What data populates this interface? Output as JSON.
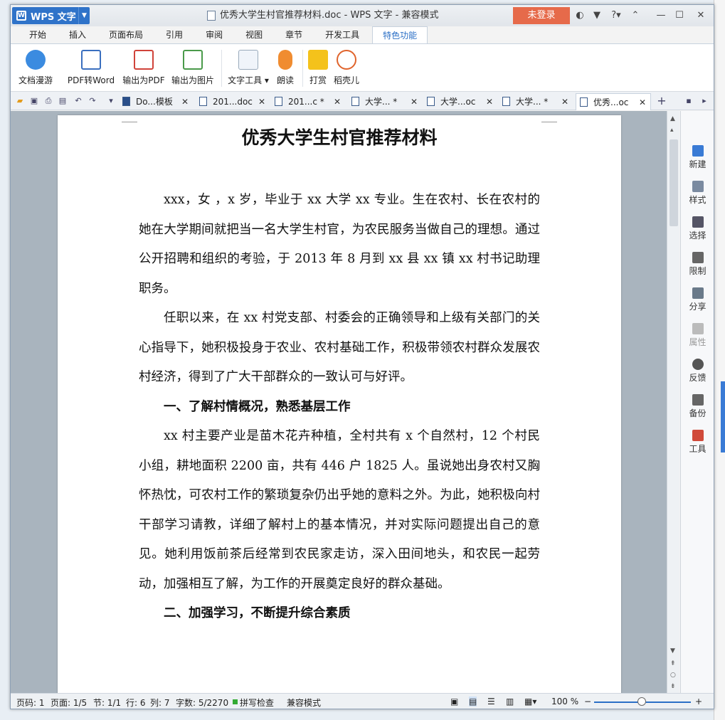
{
  "app": {
    "name": "WPS 文字",
    "window_title": "优秀大学生村官推荐材料.doc - WPS 文字 - 兼容模式",
    "login_label": "未登录"
  },
  "ribbon_tabs": [
    "开始",
    "插入",
    "页面布局",
    "引用",
    "审阅",
    "视图",
    "章节",
    "开发工具",
    "特色功能"
  ],
  "active_tab": "特色功能",
  "ribbon_buttons": [
    "文档漫游",
    "PDF转Word",
    "输出为PDF",
    "输出为图片",
    "文字工具",
    "朗读",
    "打赏",
    "稻壳儿"
  ],
  "doc_tabs": [
    {
      "label": "Do...模板"
    },
    {
      "label": "201...doc"
    },
    {
      "label": "201...c *"
    },
    {
      "label": "大学... *"
    },
    {
      "label": "大学...oc"
    },
    {
      "label": "大学... *"
    },
    {
      "label": "优秀...oc"
    }
  ],
  "document": {
    "title": "优秀大学生村官推荐材料",
    "p1": "xxx，女 ，x 岁，毕业于 xx 大学 xx 专业。生在农村、长在农村的她在大学期间就把当一名大学生村官，为农民服务当做自己的理想。通过公开招聘和组织的考验，于 2013 年 8 月到 xx 县 xx 镇 xx 村书记助理职务。",
    "p2": "任职以来，在 xx 村党支部、村委会的正确领导和上级有关部门的关心指导下，她积极投身于农业、农村基础工作，积极带领农村群众发展农村经济，得到了广大干部群众的一致认可与好评。",
    "h1": "一、了解村情概况，熟悉基层工作",
    "p3": "xx 村主要产业是苗木花卉种植，全村共有 x 个自然村，12 个村民小组，耕地面积 2200 亩，共有 446 户 1825 人。虽说她出身农村又胸怀热忱，可农村工作的繁琐复杂仍出乎她的意料之外。为此，她积极向村干部学习请教，详细了解村上的基本情况，并对实际问题提出自己的意见。她利用饭前茶后经常到农民家走访，深入田间地头，和农民一起劳动，加强相互了解，为工作的开展奠定良好的群众基础。",
    "h2": "二、加强学习，不断提升综合素质"
  },
  "sidebar": [
    "新建",
    "样式",
    "选择",
    "限制",
    "分享",
    "属性",
    "反馈",
    "备份",
    "工具"
  ],
  "status": {
    "page_no": "页码: 1",
    "pages": "页面: 1/5",
    "section": "节: 1/1",
    "row": "行: 6",
    "col": "列: 7",
    "words": "字数: 5/2270",
    "spell": "拼写检查",
    "mode": "兼容模式",
    "zoom": "100 %"
  }
}
